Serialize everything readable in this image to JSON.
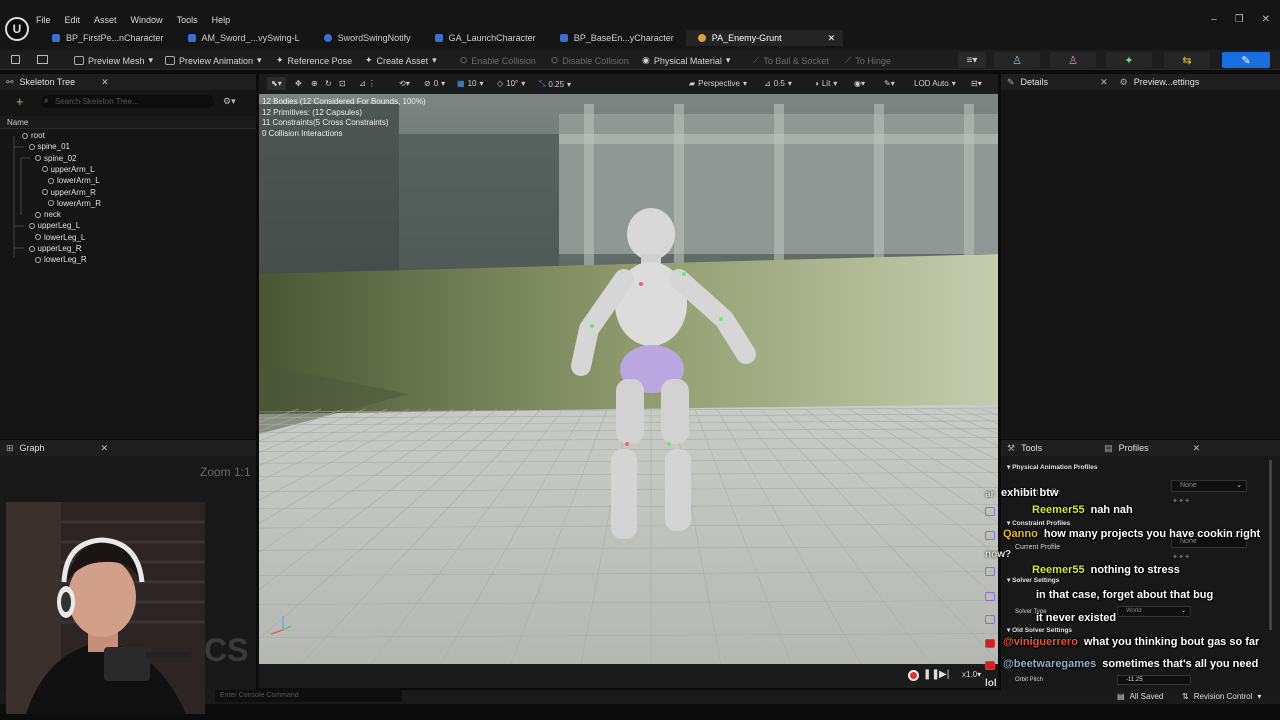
{
  "titlebar": {
    "logo": "U",
    "menu": [
      "File",
      "Edit",
      "Asset",
      "Window",
      "Tools",
      "Help"
    ],
    "window_controls": [
      "–",
      "❐",
      "✕"
    ]
  },
  "tabs": [
    {
      "label": "BP_FirstPe...nCharacter",
      "color": "#3b6fd1",
      "active": false
    },
    {
      "label": "AM_Sword_...vySwing-L",
      "color": "#3b6fd1",
      "active": false
    },
    {
      "label": "SwordSwingNotify",
      "color": "#3b6fd1",
      "active": false
    },
    {
      "label": "GA_LaunchCharacter",
      "color": "#3b6fd1",
      "active": false
    },
    {
      "label": "BP_BaseEn...yCharacter",
      "color": "#3b6fd1",
      "active": false
    },
    {
      "label": "PA_Enemy-Grunt",
      "color": "#e0a040",
      "active": true
    }
  ],
  "tab_close": "✕",
  "toolbar": {
    "preview_mesh": "Preview Mesh",
    "preview_animation": "Preview Animation",
    "reference_pose": "Reference Pose",
    "create_asset": "Create Asset",
    "enable_collision": "Enable Collision",
    "disable_collision": "Disable Collision",
    "physical_material": "Physical Material",
    "to_ball_socket": "To Ball & Socket",
    "to_hinge": "To Hinge"
  },
  "skeleton_tree": {
    "title": "Skeleton Tree",
    "search_placeholder": "Search Skeleton Tree...",
    "column_name": "Name",
    "bones": [
      {
        "label": "root",
        "indent": 0
      },
      {
        "label": "spine_01",
        "indent": 1
      },
      {
        "label": "spine_02",
        "indent": 2
      },
      {
        "label": "upperArm_L",
        "indent": 3
      },
      {
        "label": "lowerArm_L",
        "indent": 4
      },
      {
        "label": "upperArm_R",
        "indent": 3
      },
      {
        "label": "lowerArm_R",
        "indent": 4
      },
      {
        "label": "neck",
        "indent": 2
      },
      {
        "label": "upperLeg_L",
        "indent": 1
      },
      {
        "label": "lowerLeg_L",
        "indent": 2
      },
      {
        "label": "upperLeg_R",
        "indent": 1
      },
      {
        "label": "lowerLeg_R",
        "indent": 2
      }
    ]
  },
  "graph": {
    "title": "Graph",
    "zoom": "Zoom 1:1",
    "overlay_text": "CS"
  },
  "viewport": {
    "snap_rotation": "0",
    "snap_grid": "10",
    "snap_angle": "10°",
    "snap_scale": "0.25",
    "view_mode": "Perspective",
    "fov": "0.5",
    "lighting": "Lit",
    "lod": "LOD Auto",
    "stats": [
      "12 Bodies (12 Considered For Bounds, 100%)",
      "12 Primitives: (12 Capsules)",
      "11 Constraints(5 Cross Constraints)",
      "0 Collision Interactions"
    ],
    "playback_speed": "x1.0"
  },
  "details": {
    "tab_details": "Details",
    "tab_preview": "Preview...ettings"
  },
  "tools": {
    "tab_tools": "Tools",
    "tab_profiles": "Profiles",
    "sections": {
      "physical_animation_profiles": "Physical Animation Profiles",
      "constraint_profiles": "Constraint Profiles",
      "solver_settings": "Solver Settings",
      "old_solver_settings": "Old Solver Settings"
    },
    "current_profile_label": "Current Profile",
    "profile_value_1": "None",
    "profile_value_2": "None",
    "solver_type_label": "Solver Type",
    "solver_type_value": "World",
    "orbit_pitch_label": "Orbit Pitch",
    "orbit_pitch_value": "-11.25"
  },
  "console": {
    "placeholder": "Enter Console Command"
  },
  "statusbar": {
    "all_saved": "All Saved",
    "revision_control": "Revision Control"
  },
  "chat": [
    {
      "user": "",
      "text": "exhibit btw",
      "user_color": "#ffffff",
      "platform": "none"
    },
    {
      "user": "Reemer55",
      "text": "nah nah",
      "user_color": "#d4e83a",
      "platform": "twitch"
    },
    {
      "user": "Qanno",
      "text": "how many projects you have cookin right",
      "user_color": "#e6b830",
      "platform": "twitch"
    },
    {
      "user": "Reemer55",
      "text": "nothing to stress",
      "user_color": "#d4e83a",
      "platform": "twitch"
    },
    {
      "user": "",
      "text": "in that case, forget about that bug",
      "user_color": "#ffffff",
      "platform": "twitch"
    },
    {
      "user": "",
      "text": "it never existed",
      "user_color": "#ffffff",
      "platform": "twitch"
    },
    {
      "user": "@viniguerrero",
      "text": "what you thinking bout gas so far",
      "user_color": "#e2553e",
      "platform": "youtube"
    },
    {
      "user": "@beetwaregames",
      "text": "sometimes that's all you need",
      "user_color": "#8fb0c8",
      "platform": "youtube"
    }
  ],
  "chat_fragments": {
    "ar": "ar",
    "now": "now?",
    "lol": "lol"
  },
  "colors": {
    "accent_blue": "#1a6fe0",
    "active_tab_icon": "#e0a040",
    "username_yellow": "#d4e83a",
    "username_orange": "#e6b830",
    "username_red": "#e2553e"
  }
}
